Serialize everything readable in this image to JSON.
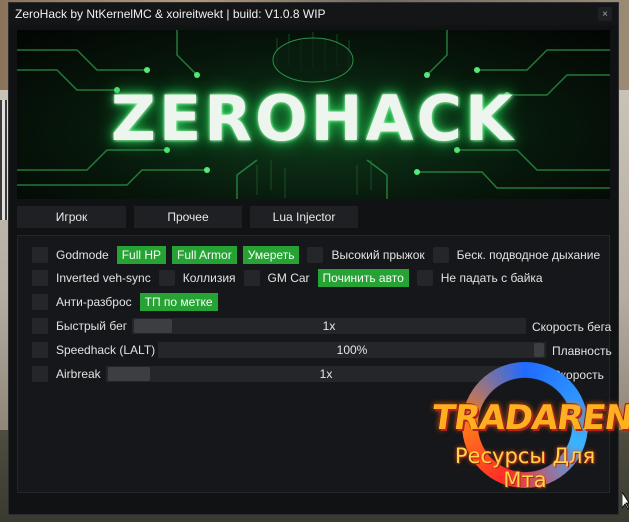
{
  "window": {
    "title": "ZeroHack by NtKernelMC & xoireitwekt | build: V1.0.8 WIP",
    "close_icon": "×"
  },
  "banner": {
    "title": "ZEROHACK"
  },
  "tabs": [
    {
      "label": "Игрок"
    },
    {
      "label": "Прочее"
    },
    {
      "label": "Lua Injector"
    }
  ],
  "features": {
    "row1": {
      "godmode": "Godmode",
      "full_hp": "Full HP",
      "full_armor": "Full Armor",
      "die": "Умереть",
      "high_jump": "Высокий прыжок",
      "infinite_breath": "Беск. подводное дыхание"
    },
    "row2": {
      "inverted_veh_sync": "Inverted veh-sync",
      "collision": "Коллизия",
      "gm_car": "GM Car",
      "repair_car": "Починить авто",
      "no_fall_bike": "Не падать с байка"
    },
    "row3": {
      "anti_spread": "Анти-разброс",
      "tp_marker": "ТП по метке"
    },
    "row4": {
      "fast_run": "Быстрый бег",
      "value": "1x",
      "right_label": "Скорость бега"
    },
    "row5": {
      "speedhack": "Speedhack (LALT)",
      "value": "100%",
      "right_label": "Плавность"
    },
    "row6": {
      "airbreak": "Airbreak",
      "value": "1x",
      "right_label": "Скорость"
    }
  },
  "watermark": {
    "title": "TRADARENA",
    "subtitle": "Ресурсы Для Мта"
  },
  "colors": {
    "accent_green": "#27a336",
    "window_bg": "#111214",
    "panel_bg": "#16171a",
    "control_bg": "#25262a"
  }
}
